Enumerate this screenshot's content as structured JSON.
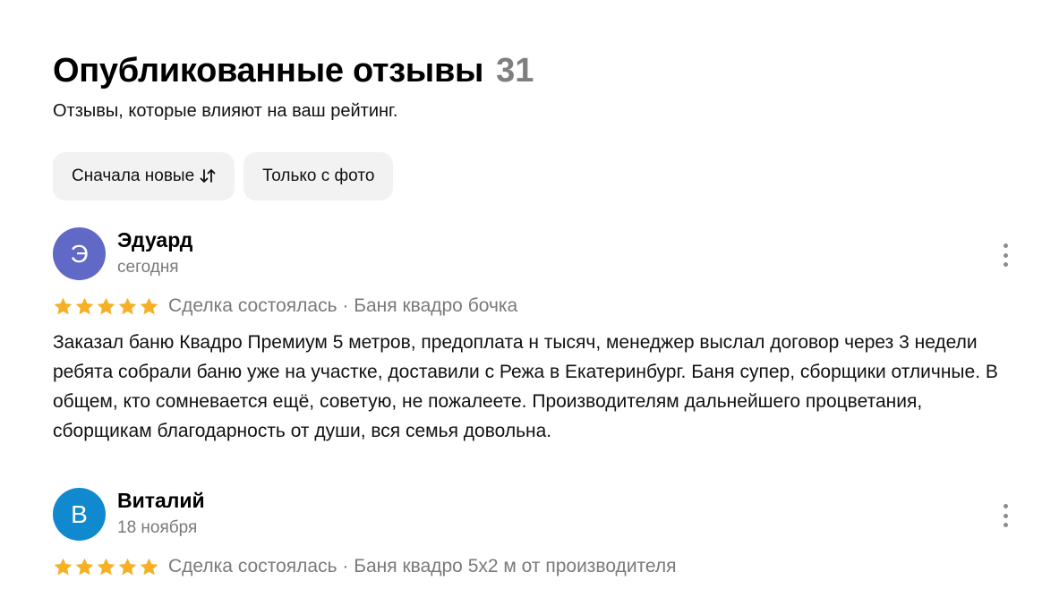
{
  "header": {
    "title": "Опубликованные отзывы",
    "count": "31",
    "subtitle": "Отзывы, которые влияют на ваш рейтинг."
  },
  "filters": {
    "sort_label": "Сначала новые",
    "sort_icon": "sort-arrows-icon",
    "photo_label": "Только с фото"
  },
  "reviews": [
    {
      "initial": "Э",
      "avatar_color": "#6069c6",
      "author": "Эдуард",
      "date": "сегодня",
      "rating": 5,
      "meta": "Сделка состоялась · Баня квадро бочка",
      "text": "Заказал баню Квадро Премиум 5 метров, предоплата н тысяч, менеджер выслал договор через 3 недели ребята собрали баню уже на участке, доставили с Режа в Екатеринбург. Баня супер, сборщики отличные. В общем, кто сомневается ещё, советую, не пожалеете. Производителям дальнейшего процветания, сборщикам благодарность от души, вся семья довольна."
    },
    {
      "initial": "В",
      "avatar_color": "#1189cf",
      "author": "Виталий",
      "date": "18 ноября",
      "rating": 5,
      "meta": "Сделка состоялась · Баня квадро 5х2 м от производителя",
      "text": ""
    }
  ],
  "colors": {
    "star": "#f5b025",
    "chip_bg": "#f2f2f2",
    "muted_text": "#7a7a7a"
  }
}
